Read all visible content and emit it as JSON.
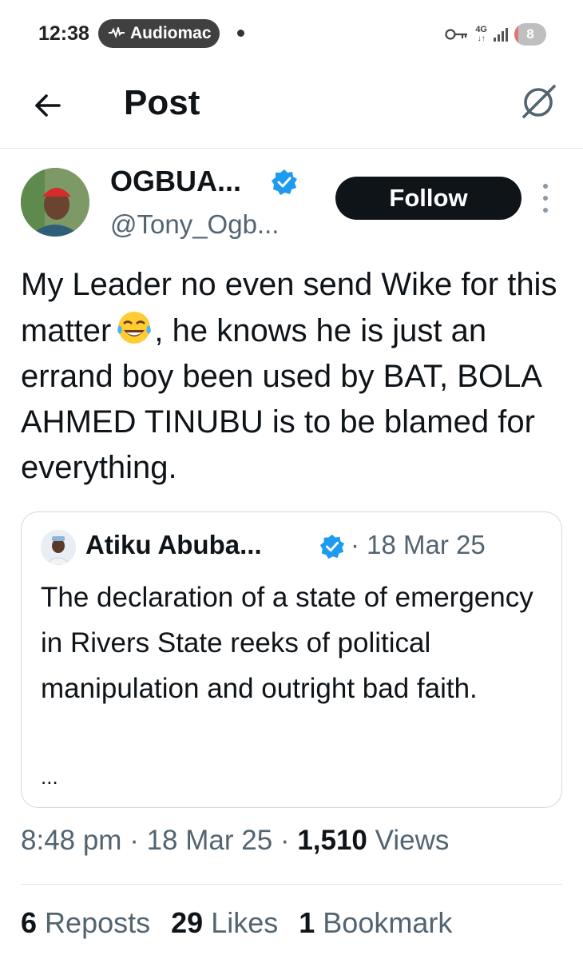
{
  "status_bar": {
    "time": "12:38",
    "media_app": "Audiomac",
    "network": "4G",
    "battery_level": "8",
    "battery_fraction": 0.08
  },
  "header": {
    "title": "Post"
  },
  "post": {
    "author_name": "OGBUA...",
    "author_handle": "@Tony_Ogb...",
    "follow_label": "Follow",
    "text_before_emoji": "My Leader no even send Wike for this matter",
    "emoji_name": "face-with-tears-of-joy",
    "text_after_emoji": ", he knows he is just an errand boy been used by BAT, BOLA AHMED TINUBU is to be blamed for everything.",
    "time": "8:48 pm",
    "date": "18 Mar 25",
    "views_count": "1,510",
    "views_label": "Views",
    "separator": "·"
  },
  "quoted_post": {
    "author_name": "Atiku Abuba...",
    "date": "18 Mar 25",
    "separator": "·",
    "text": "The declaration of a state of emergency in Rivers State reeks of political manipulation and outright bad faith.",
    "ellipsis": "..."
  },
  "stats": [
    {
      "count": "6",
      "label": "Reposts"
    },
    {
      "count": "29",
      "label": "Likes"
    },
    {
      "count": "1",
      "label": "Bookmark"
    }
  ],
  "colors": {
    "verified": "#1d9bf0",
    "secondary_text": "#536471",
    "primary_text": "#0f1419"
  }
}
